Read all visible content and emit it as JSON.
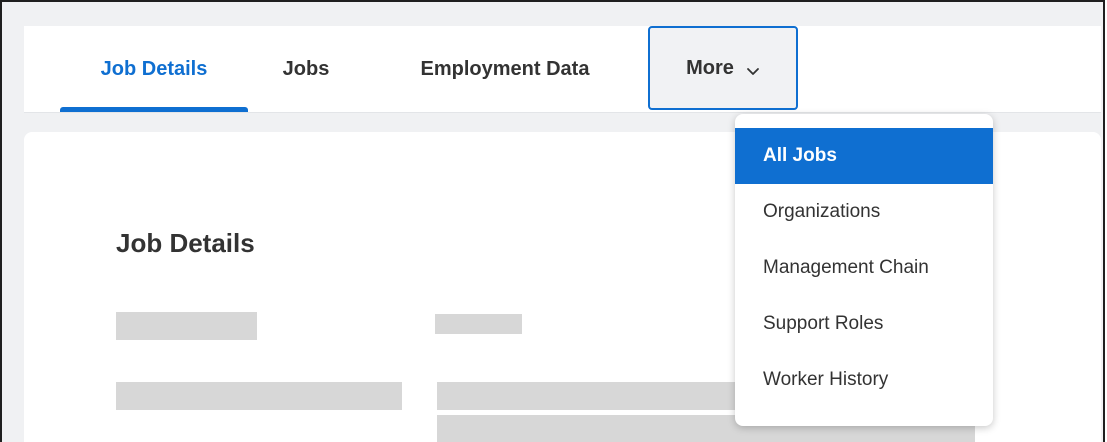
{
  "tabs": [
    {
      "label": "Job Details",
      "active": true
    },
    {
      "label": "Jobs",
      "active": false
    },
    {
      "label": "Employment Data",
      "active": false
    }
  ],
  "more_tab": {
    "label": "More",
    "icon": "chevron-down-icon"
  },
  "main": {
    "section_title": "Job Details"
  },
  "dropdown": {
    "items": [
      {
        "label": "All Jobs",
        "selected": true
      },
      {
        "label": "Organizations",
        "selected": false
      },
      {
        "label": "Management Chain",
        "selected": false
      },
      {
        "label": "Support Roles",
        "selected": false
      },
      {
        "label": "Worker History",
        "selected": false
      }
    ]
  },
  "colors": {
    "accent": "#0f6fd1",
    "placeholder": "#d7d7d7",
    "background": "#f0f1f3",
    "text": "#333333"
  }
}
